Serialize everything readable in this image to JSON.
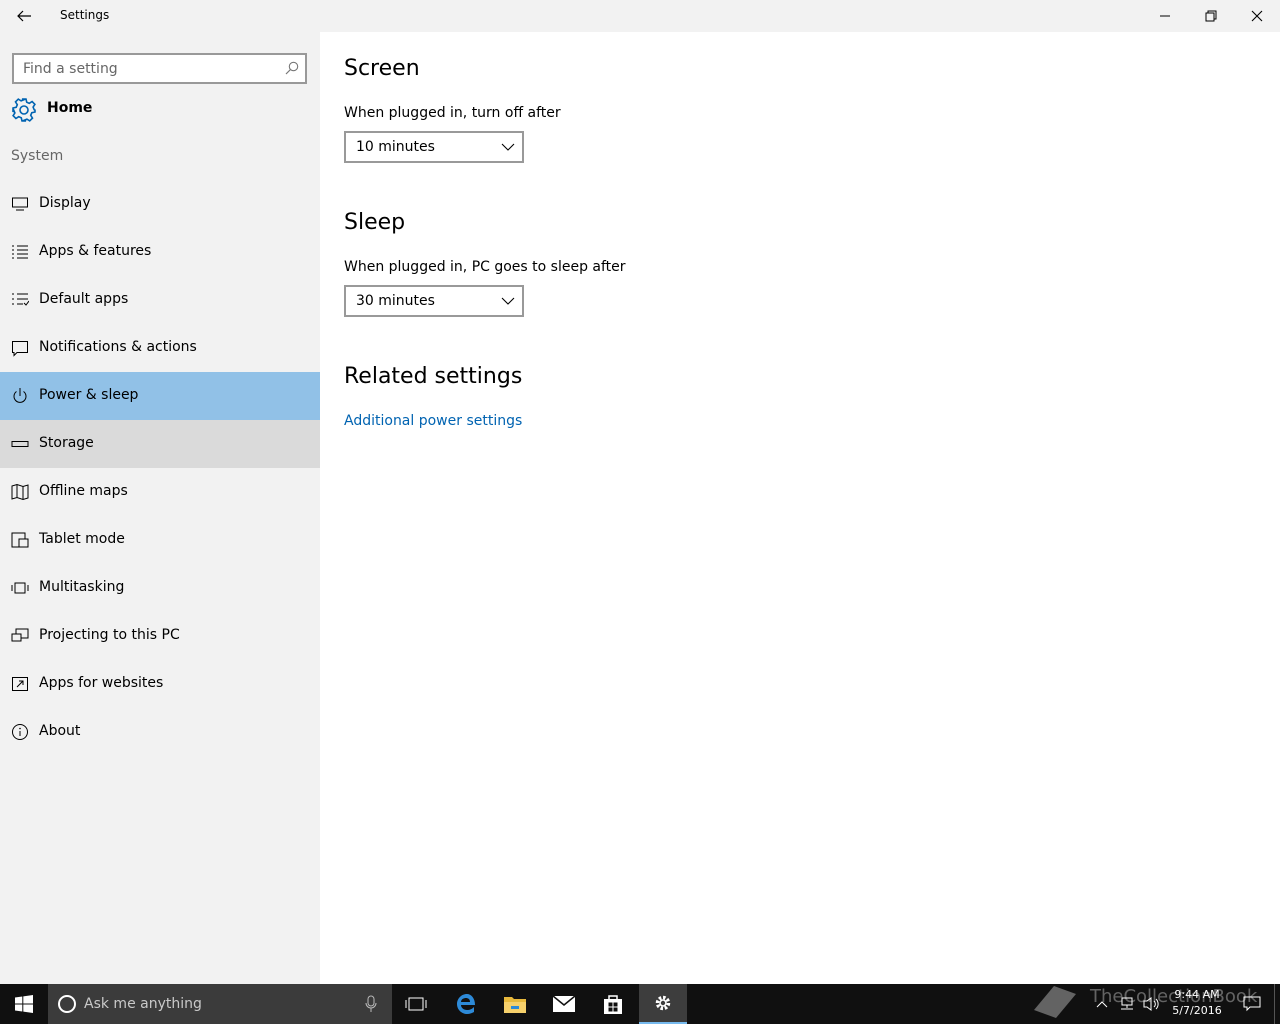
{
  "window": {
    "title": "Settings"
  },
  "search": {
    "placeholder": "Find a setting"
  },
  "home": {
    "label": "Home"
  },
  "section": {
    "label": "System"
  },
  "nav": {
    "items": [
      {
        "label": "Display",
        "icon": "monitor-icon"
      },
      {
        "label": "Apps & features",
        "icon": "list-icon"
      },
      {
        "label": "Default apps",
        "icon": "default-apps-icon"
      },
      {
        "label": "Notifications & actions",
        "icon": "message-icon"
      },
      {
        "label": "Power & sleep",
        "icon": "power-icon",
        "selected": true
      },
      {
        "label": "Storage",
        "icon": "drive-icon",
        "hover": true
      },
      {
        "label": "Offline maps",
        "icon": "map-icon"
      },
      {
        "label": "Tablet mode",
        "icon": "tablet-icon"
      },
      {
        "label": "Multitasking",
        "icon": "multitask-icon"
      },
      {
        "label": "Projecting to this PC",
        "icon": "project-icon"
      },
      {
        "label": "Apps for websites",
        "icon": "web-apps-icon"
      },
      {
        "label": "About",
        "icon": "info-icon"
      }
    ]
  },
  "content": {
    "screen": {
      "heading": "Screen",
      "label": "When plugged in, turn off after",
      "value": "10 minutes"
    },
    "sleep": {
      "heading": "Sleep",
      "label": "When plugged in, PC goes to sleep after",
      "value": "30 minutes"
    },
    "related": {
      "heading": "Related settings",
      "link": "Additional power settings"
    }
  },
  "taskbar": {
    "search_placeholder": "Ask me anything",
    "time": "9:44 AM",
    "date": "5/7/2016",
    "watermark": "TheCollectionBook"
  },
  "colors": {
    "selected": "#91c1e7",
    "hover": "#dadada",
    "link": "#0063b1",
    "accent": "#0078d7"
  }
}
